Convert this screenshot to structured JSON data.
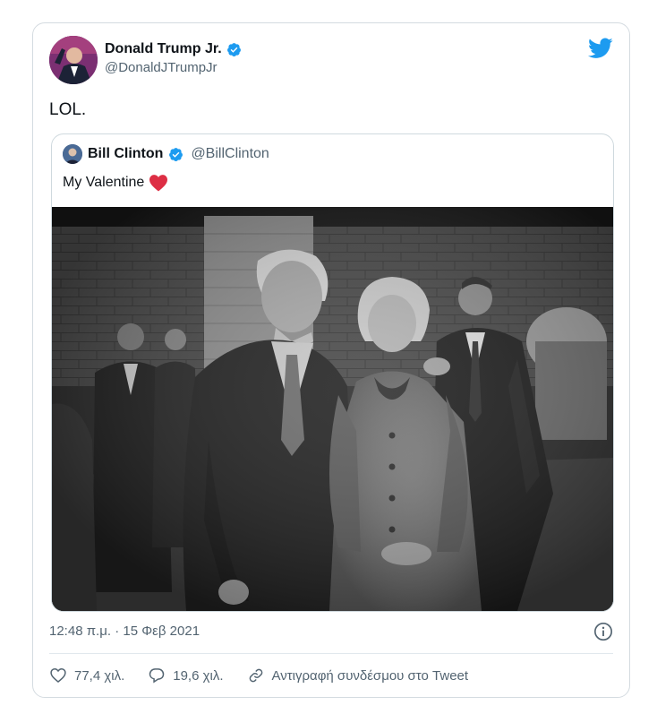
{
  "tweet": {
    "author_name": "Donald Trump Jr.",
    "author_handle": "@DonaldJTrumpJr",
    "text": "LOL.",
    "timestamp": "12:48 π.μ. · 15 Φεβ 2021"
  },
  "quoted": {
    "author_name": "Bill Clinton",
    "author_handle": "@BillClinton",
    "text": "My Valentine"
  },
  "actions": {
    "likes": "77,4 χιλ.",
    "replies": "19,6 χιλ.",
    "copy_link": "Αντιγραφή συνδέσμου στο Tweet"
  },
  "colors": {
    "brand": "#1d9bf0",
    "heart": "#e0245e"
  },
  "icons": [
    "verified-badge-icon",
    "twitter-bird-icon",
    "heart-emoji-icon",
    "info-icon",
    "heart-icon",
    "reply-icon",
    "link-icon"
  ]
}
